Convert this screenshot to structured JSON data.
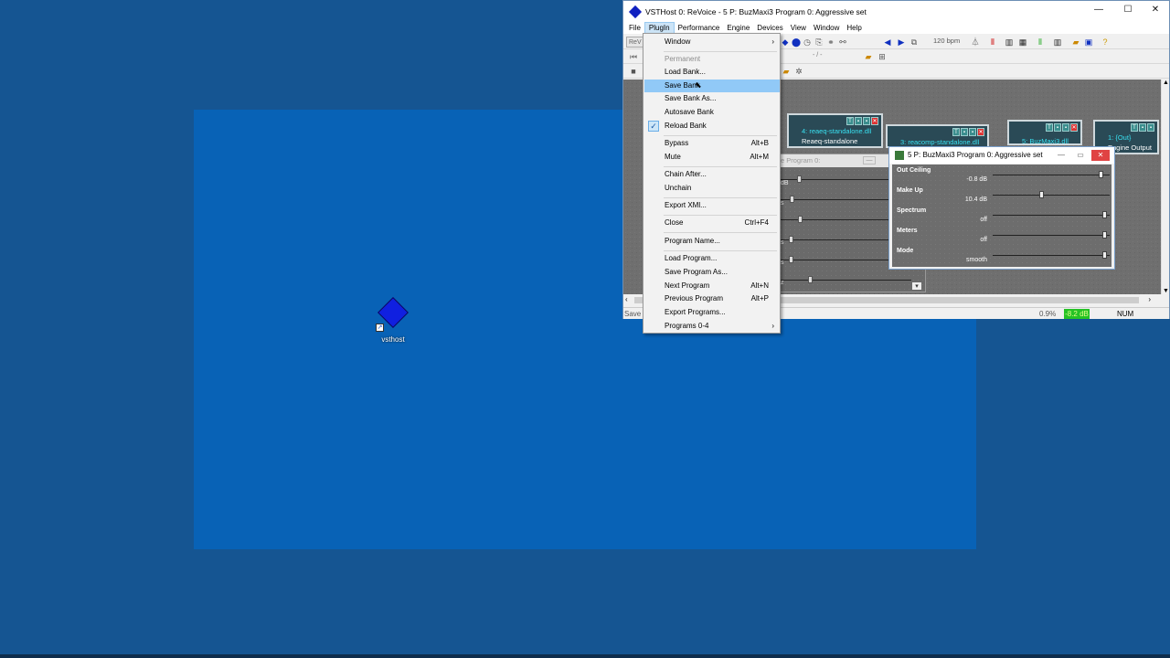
{
  "desktop": {
    "icon_label": "vsthost"
  },
  "window": {
    "title": "VSTHost 0: ReVoice - 5 P: BuzMaxi3 Program 0: Aggressive set",
    "controls": {
      "minimize": "—",
      "maximize": "☐",
      "close": "✕"
    },
    "menu": [
      "File",
      "PlugIn",
      "Performance",
      "Engine",
      "Devices",
      "View",
      "Window",
      "Help"
    ],
    "toolbar": {
      "bpm": "120 bpm",
      "combo_prefix": "ReV",
      "position": "- / -"
    },
    "status": {
      "left": "Save a",
      "cpu": "0.9%",
      "level": "-8.2 dB",
      "num": "NUM"
    }
  },
  "plugins": [
    {
      "name": "4: reaeq-standalone.dll",
      "sub": "Reaeq-standalone"
    },
    {
      "name": "3: reacomp-standalone.dll",
      "sub": ""
    },
    {
      "name": "5: BuzMaxi3.dll",
      "sub": ""
    },
    {
      "name": "1: {Out}",
      "sub": "Engine Output"
    }
  ],
  "back_window": {
    "title_fragment": "e Program 0:",
    "fragments": [
      "dB",
      "s",
      "s",
      "s",
      "z"
    ]
  },
  "param_window": {
    "title": "5 P: BuzMaxi3 Program 0: Aggressive set",
    "params": [
      {
        "name": "Out Ceiling",
        "value": "-0.8 dB",
        "level": 0.95
      },
      {
        "name": "Make Up",
        "value": "10.4 dB",
        "level": 0.42
      },
      {
        "name": "Spectrum",
        "value": "off",
        "level": 0.98
      },
      {
        "name": "Meters",
        "value": "off",
        "level": 0.98
      },
      {
        "name": "Mode",
        "value": "smooth",
        "level": 0.98
      }
    ]
  },
  "plugin_menu": {
    "items": [
      {
        "label": "Window",
        "shortcut": "",
        "submenu": true,
        "state": "normal"
      },
      {
        "label": "Permanent",
        "shortcut": "",
        "submenu": false,
        "state": "disabled"
      },
      {
        "label": "Load Bank...",
        "shortcut": "",
        "submenu": false,
        "state": "normal"
      },
      {
        "label": "Save Bank",
        "shortcut": "",
        "submenu": false,
        "state": "highlighted"
      },
      {
        "label": "Save Bank As...",
        "shortcut": "",
        "submenu": false,
        "state": "normal"
      },
      {
        "label": "Autosave Bank",
        "shortcut": "",
        "submenu": false,
        "state": "normal"
      },
      {
        "label": "Reload Bank",
        "shortcut": "",
        "submenu": false,
        "state": "checked"
      },
      {
        "label": "Bypass",
        "shortcut": "Alt+B",
        "submenu": false,
        "state": "normal"
      },
      {
        "label": "Mute",
        "shortcut": "Alt+M",
        "submenu": false,
        "state": "normal"
      },
      {
        "label": "Chain After...",
        "shortcut": "",
        "submenu": false,
        "state": "normal"
      },
      {
        "label": "Unchain",
        "shortcut": "",
        "submenu": false,
        "state": "normal"
      },
      {
        "label": "Export XMl...",
        "shortcut": "",
        "submenu": false,
        "state": "normal"
      },
      {
        "label": "Close",
        "shortcut": "Ctrl+F4",
        "submenu": false,
        "state": "normal"
      },
      {
        "label": "Program Name...",
        "shortcut": "",
        "submenu": false,
        "state": "normal"
      },
      {
        "label": "Load Program...",
        "shortcut": "",
        "submenu": false,
        "state": "normal"
      },
      {
        "label": "Save Program As...",
        "shortcut": "",
        "submenu": false,
        "state": "normal"
      },
      {
        "label": "Next Program",
        "shortcut": "Alt+N",
        "submenu": false,
        "state": "normal"
      },
      {
        "label": "Previous Program",
        "shortcut": "Alt+P",
        "submenu": false,
        "state": "normal"
      },
      {
        "label": "Export Programs...",
        "shortcut": "",
        "submenu": false,
        "state": "normal"
      },
      {
        "label": "Programs 0-4",
        "shortcut": "",
        "submenu": true,
        "state": "normal"
      }
    ]
  },
  "colors": {
    "desktop": "#155592",
    "inner_desktop": "#0862b6",
    "menu_highlight": "#91c9f7",
    "close_red": "#e04343"
  }
}
